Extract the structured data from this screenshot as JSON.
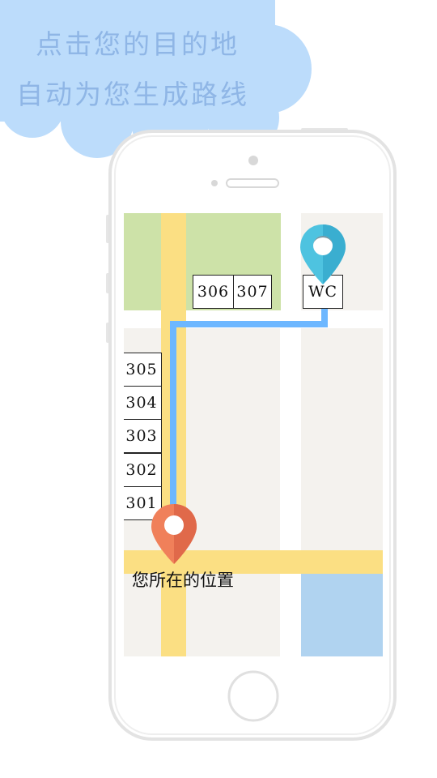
{
  "banner": {
    "line1": "点击您的目的地",
    "line2": "自动为您生成路线"
  },
  "map": {
    "rooms": [
      "306",
      "307",
      "305",
      "304",
      "303",
      "302",
      "301"
    ],
    "destination_label": "WC",
    "current_location_label": "您所在的位置"
  },
  "colors": {
    "cloud": "#bcdcfb",
    "cloud_text": "#8fb6e6",
    "road": "#fbdf83",
    "park": "#cde2a8",
    "building": "#f4f2ee",
    "water": "#b0d3f0",
    "route": "#6db7ff",
    "destination_pin": "#4ec3e0",
    "location_pin": "#f0805a"
  },
  "icons": {
    "destination": "map-pin-icon",
    "current_location": "map-pin-icon",
    "home_button": "home-button-icon"
  }
}
